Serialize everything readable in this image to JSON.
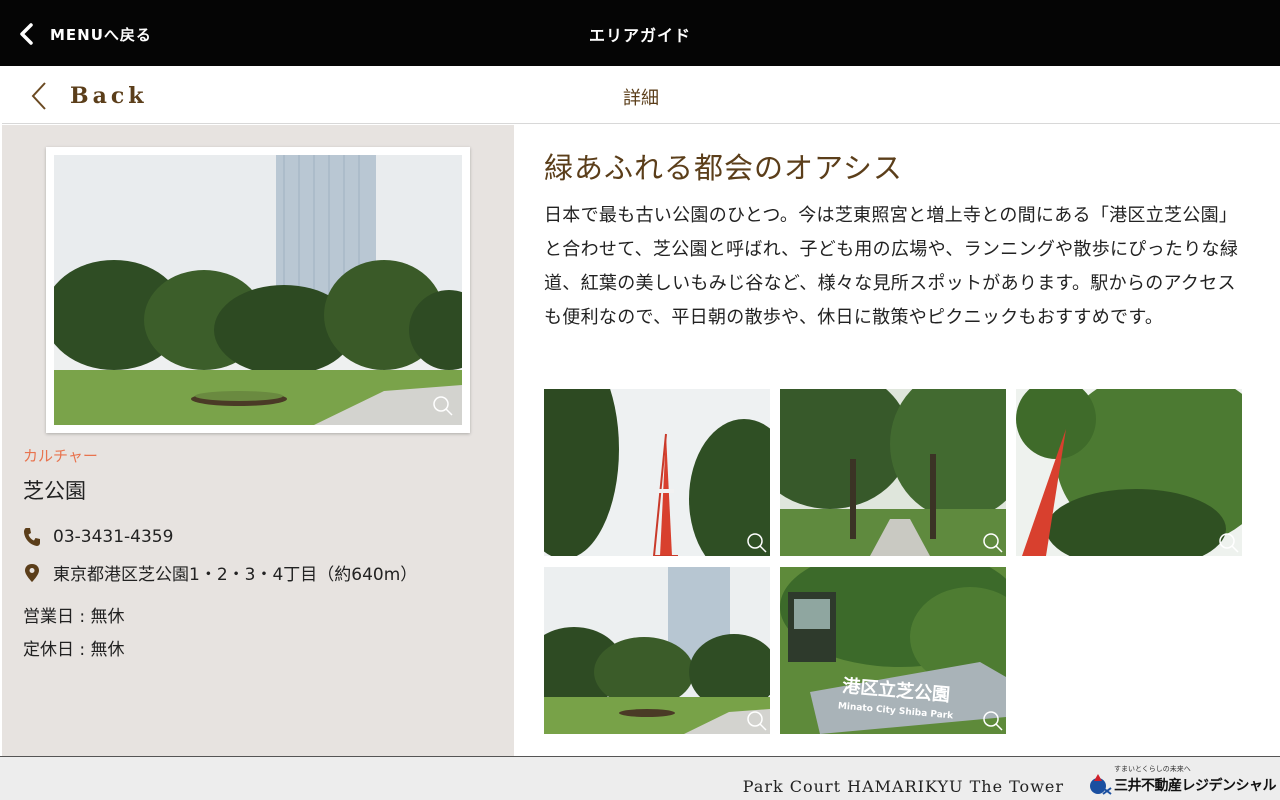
{
  "topbar": {
    "back_label": "MENUへ戻る",
    "title": "エリアガイド"
  },
  "subbar": {
    "back_label": "Back",
    "title": "詳細"
  },
  "spot": {
    "category": "カルチャー",
    "name": "芝公園",
    "phone": "03-3431-4359",
    "address": "東京都港区芝公園1・2・3・4丁目（約640m）",
    "business_days": "営業日 : 無休",
    "closed_days": "定休日 : 無休"
  },
  "detail": {
    "headline": "緑あふれる都会のオアシス",
    "description": "日本で最も古い公園のひとつ。今は芝東照宮と増上寺との間にある「港区立芝公園」と合わせて、芝公園と呼ばれ、子ども用の広場や、ランニングや散歩にぴったりな緑道、紅葉の美しいもみじ谷など、様々な見所スポットがあります。駅からのアクセスも便利なので、平日朝の散歩や、休日に散策やピクニックもおすすめです。"
  },
  "gallery": {
    "sign_text": "港区立芝公園",
    "sign_subtext": "Minato City Shiba Park"
  },
  "footer": {
    "property_name": "Park Court HAMARIKYU The Tower",
    "logo_tagline": "すまいとくらしの未来へ",
    "logo_text": "三井不動産レジデンシャル"
  },
  "colors": {
    "brown": "#5b3e1a",
    "accent": "#e8734e",
    "panel": "#e7e3e0",
    "brand_blue": "#1a4fa0",
    "brand_red": "#d0202a"
  },
  "icons": [
    "chevron-left-icon",
    "back-chevron-icon",
    "phone-icon",
    "location-pin-icon",
    "zoom-icon",
    "mitsui-logo-icon"
  ]
}
